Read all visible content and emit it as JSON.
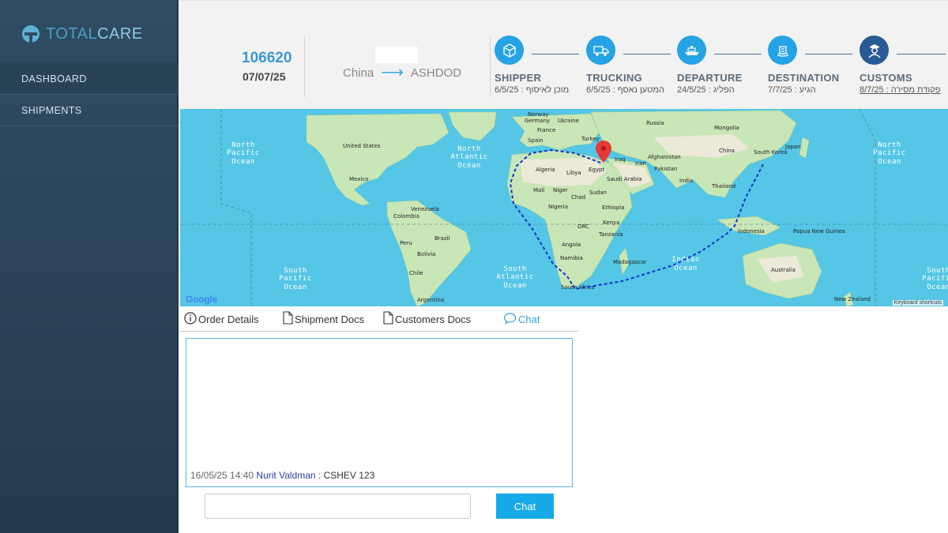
{
  "brand": {
    "part1": "TOTAL",
    "part2": "CARE"
  },
  "sidebar": {
    "items": [
      {
        "label": "DASHBOARD"
      },
      {
        "label": "SHIPMENTS"
      }
    ]
  },
  "header": {
    "order_number": "106620",
    "order_date": "07/07/25",
    "route": {
      "origin": "China",
      "arrow": "⟶",
      "destination": "ASHDOD"
    }
  },
  "steps": [
    {
      "title": "SHIPPER",
      "subtitle": "6/5/25 : מוכן לאיסוף",
      "icon": "box-icon"
    },
    {
      "title": "TRUCKING",
      "subtitle": "6/5/25 : המטען נאסף",
      "icon": "truck-icon"
    },
    {
      "title": "DEPARTURE",
      "subtitle": "24/5/25 : הפליג",
      "icon": "ship-icon"
    },
    {
      "title": "DESTINATION",
      "subtitle": "7/7/25 : הגיע",
      "icon": "port-icon"
    },
    {
      "title": "CUSTOMS",
      "subtitle": "8/7/25 : פקודת מסירה",
      "icon": "customs-officer-icon"
    }
  ],
  "map": {
    "oceans": {
      "north_pacific_left": [
        "North",
        "Pacific",
        "Ocean"
      ],
      "north_atlantic": [
        "North",
        "Atlantic",
        "Ocean"
      ],
      "north_pacific_right": [
        "North",
        "Pacific",
        "Ocean"
      ],
      "south_pacific_left": [
        "South",
        "Pacific",
        "Ocean"
      ],
      "south_atlantic": [
        "South",
        "Atlantic",
        "Ocean"
      ],
      "indian": [
        "Indian",
        "Ocean"
      ],
      "south_pacific_right": [
        "South",
        "Pacific",
        "Ocean"
      ]
    },
    "places": [
      "Norway",
      "Germany",
      "Ukraine",
      "Russia",
      "Mongolia",
      "France",
      "Turkey",
      "Spain",
      "China",
      "South Korea",
      "Japan",
      "Iraq",
      "Iran",
      "Afghanistan",
      "Pakistan",
      "Algeria",
      "Libya",
      "Egypt",
      "Saudi Arabia",
      "India",
      "Thailand",
      "Mali",
      "Niger",
      "Chad",
      "Sudan",
      "Nigeria",
      "Ethiopia",
      "DRC",
      "Kenya",
      "Tanzania",
      "Angola",
      "Namibia",
      "Madagascar",
      "South Africa",
      "Indonesia",
      "Papua New Guinea",
      "Australia",
      "New Zealand",
      "United States",
      "Mexico",
      "Venezuela",
      "Colombia",
      "Peru",
      "Brazil",
      "Bolivia",
      "Chile",
      "Argentina"
    ],
    "keyboard_shortcuts": "Keyboard shortcuts",
    "google": "Google"
  },
  "tabs": [
    {
      "label": "Order Details",
      "icon": "info-icon"
    },
    {
      "label": "Shipment Docs",
      "icon": "document-icon"
    },
    {
      "label": "Customers Docs",
      "icon": "document-icon"
    },
    {
      "label": "Chat",
      "icon": "chat-bubble-icon"
    }
  ],
  "chat": {
    "messages": [
      {
        "timestamp": "16/05/25 14:40",
        "author": "Nurit Valdman",
        "separator": " : ",
        "text": "CSHEV 123"
      }
    ],
    "input_value": "",
    "send_label": "Chat"
  },
  "colors": {
    "accent": "#25a3e4",
    "sidebar": "#2f4c63",
    "current_step": "#2a5a93",
    "route_line": "#1234c8",
    "marker": "#e53935"
  }
}
